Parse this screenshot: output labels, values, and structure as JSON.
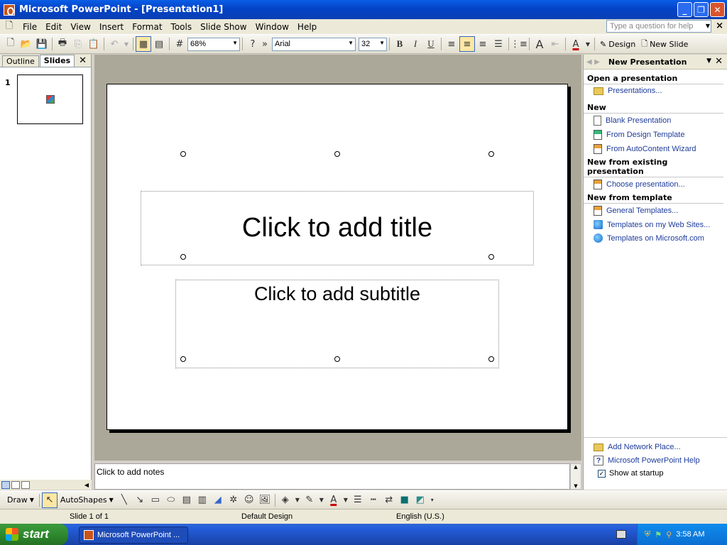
{
  "window": {
    "title": "Microsoft PowerPoint - [Presentation1]"
  },
  "menubar": {
    "items": [
      "File",
      "Edit",
      "View",
      "Insert",
      "Format",
      "Tools",
      "Slide Show",
      "Window",
      "Help"
    ],
    "help_placeholder": "Type a question for help",
    "close_glyph": "×"
  },
  "toolbar": {
    "zoom": "68%",
    "font": "Arial",
    "font_size": "32",
    "bold": "B",
    "italic": "I",
    "underline": "U",
    "design_label": "Design",
    "new_slide_label": "New Slide"
  },
  "left_pane": {
    "tabs": [
      "Outline",
      "Slides"
    ],
    "active_tab": "Slides",
    "slide_number": "1"
  },
  "slide": {
    "title_placeholder": "Click to add title",
    "subtitle_placeholder": "Click to add subtitle"
  },
  "notes": {
    "placeholder": "Click to add notes"
  },
  "task_pane": {
    "title": "New Presentation",
    "sections": [
      {
        "heading": "Open a presentation",
        "links": [
          {
            "label": "Presentations...",
            "icon": "folder-open-icon"
          }
        ]
      },
      {
        "heading": "New",
        "links": [
          {
            "label": "Blank Presentation",
            "icon": "blank-page-icon"
          },
          {
            "label": "From Design Template",
            "icon": "design-template-icon"
          },
          {
            "label": "From AutoContent Wizard",
            "icon": "wizard-icon"
          }
        ]
      },
      {
        "heading": "New from existing presentation",
        "links": [
          {
            "label": "Choose presentation...",
            "icon": "existing-presentation-icon"
          }
        ]
      },
      {
        "heading": "New from template",
        "links": [
          {
            "label": "General Templates...",
            "icon": "template-icon"
          },
          {
            "label": "Templates on my Web Sites...",
            "icon": "web-sites-icon"
          },
          {
            "label": "Templates on Microsoft.com",
            "icon": "globe-icon"
          }
        ]
      }
    ],
    "bottom_links": [
      {
        "label": "Add Network Place...",
        "icon": "network-folder-icon"
      },
      {
        "label": "Microsoft PowerPoint Help",
        "icon": "help-icon"
      }
    ],
    "show_at_startup": "Show at startup"
  },
  "drawbar": {
    "draw_label": "Draw",
    "autoshapes_label": "AutoShapes"
  },
  "statusbar": {
    "slide_info": "Slide 1 of 1",
    "design": "Default Design",
    "language": "English (U.S.)"
  },
  "taskbar": {
    "start_label": "start",
    "task_button": "Microsoft PowerPoint ...",
    "clock": "3:58 AM"
  }
}
